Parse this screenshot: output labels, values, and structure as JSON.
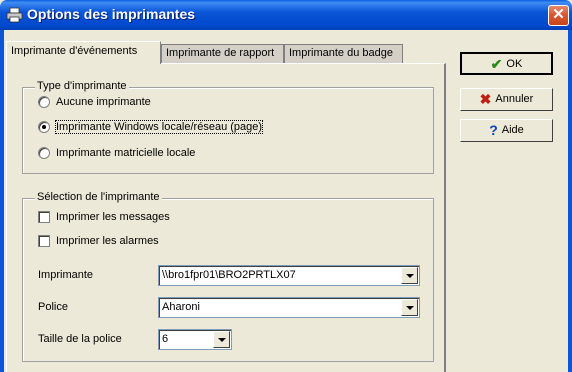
{
  "window": {
    "title": "Options des imprimantes",
    "close_glyph": "✕"
  },
  "tabs": [
    {
      "label": "Imprimante d'événements",
      "active": true
    },
    {
      "label": "Imprimante de rapport",
      "active": false
    },
    {
      "label": "Imprimante du badge",
      "active": false
    }
  ],
  "printer_type": {
    "legend": "Type d'imprimante",
    "options": [
      {
        "label": "Aucune imprimante",
        "selected": false
      },
      {
        "label": "Imprimante Windows locale/réseau (page)",
        "selected": true
      },
      {
        "label": "Imprimante matricielle locale",
        "selected": false
      }
    ]
  },
  "printer_selection": {
    "legend": "Sélection de l'imprimante",
    "checkboxes": [
      {
        "label": "Imprimer les messages",
        "checked": false
      },
      {
        "label": "Imprimer les alarmes",
        "checked": false
      }
    ],
    "printer": {
      "label": "Imprimante",
      "value": "\\\\bro1fpr01\\BRO2PRTLX07"
    },
    "font": {
      "label": "Police",
      "value": "Aharoni"
    },
    "font_size": {
      "label": "Taille de la police",
      "value": "6"
    }
  },
  "buttons": {
    "ok": {
      "label": "OK",
      "icon": "check-icon"
    },
    "cancel": {
      "label": "Annuler",
      "icon": "x-icon"
    },
    "help": {
      "label": "Aide",
      "icon": "question-icon"
    }
  },
  "colors": {
    "title_bar": "#0b56d8",
    "ok_icon": "#2a8a1a",
    "cancel_icon": "#c02010",
    "help_icon": "#0a40c0"
  }
}
